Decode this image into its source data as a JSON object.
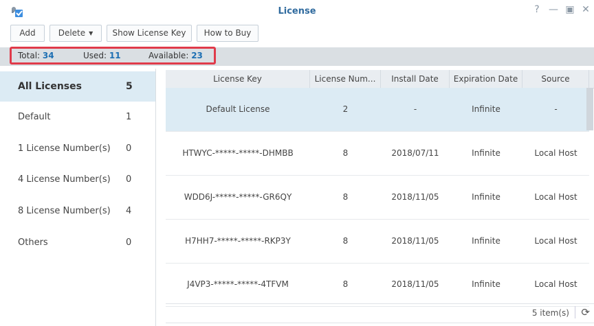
{
  "window": {
    "title": "License"
  },
  "toolbar": {
    "add": "Add",
    "delete": "Delete",
    "show_key": "Show License Key",
    "how_to_buy": "How to Buy"
  },
  "stats": {
    "total_label": "Total:",
    "total": "34",
    "used_label": "Used:",
    "used": "11",
    "available_label": "Available:",
    "available": "23"
  },
  "sidebar": {
    "items": [
      {
        "label": "All Licenses",
        "count": "5"
      },
      {
        "label": "Default",
        "count": "1"
      },
      {
        "label": "1 License Number(s)",
        "count": "0"
      },
      {
        "label": "4 License Number(s)",
        "count": "0"
      },
      {
        "label": "8 License Number(s)",
        "count": "4"
      },
      {
        "label": "Others",
        "count": "0"
      }
    ]
  },
  "table": {
    "headers": [
      "License Key",
      "License Num...",
      "Install Date",
      "Expiration Date",
      "Source"
    ],
    "rows": [
      [
        "Default License",
        "2",
        "-",
        "Infinite",
        "-"
      ],
      [
        "HTWYC-*****-*****-DHMBB",
        "8",
        "2018/07/11",
        "Infinite",
        "Local Host"
      ],
      [
        "WDD6J-*****-*****-GR6QY",
        "8",
        "2018/11/05",
        "Infinite",
        "Local Host"
      ],
      [
        "H7HH7-*****-*****-RKP3Y",
        "8",
        "2018/11/05",
        "Infinite",
        "Local Host"
      ],
      [
        "J4VP3-*****-*****-4TFVM",
        "8",
        "2018/11/05",
        "Infinite",
        "Local Host"
      ]
    ]
  },
  "footer": {
    "items": "5 item(s)"
  },
  "colors": {
    "accent": "#1d6fb3",
    "highlight": "#e03a4a",
    "selected": "#dcebf4"
  }
}
